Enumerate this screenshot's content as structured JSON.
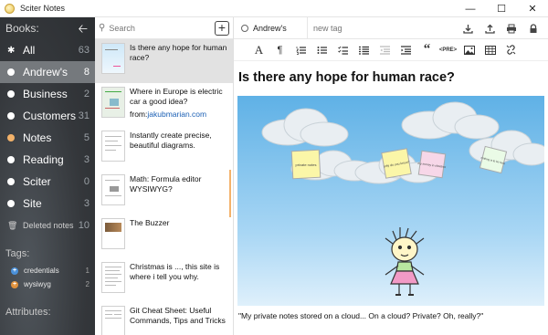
{
  "window": {
    "title": "Sciter Notes"
  },
  "sidebar": {
    "header": "Books:",
    "books": [
      {
        "label": "All",
        "count": "63",
        "icon": "star-icon"
      },
      {
        "label": "Andrew's",
        "count": "8",
        "selected": true
      },
      {
        "label": "Business",
        "count": "2"
      },
      {
        "label": "Customers",
        "count": "31"
      },
      {
        "label": "Notes",
        "count": "5",
        "dot_color": "#f3b26a"
      },
      {
        "label": "Reading",
        "count": "3"
      },
      {
        "label": "Sciter",
        "count": "0"
      },
      {
        "label": "Site",
        "count": "3"
      },
      {
        "label": "Deleted notes",
        "count": "10",
        "icon": "trash-icon"
      }
    ],
    "tags_header": "Tags:",
    "tags": [
      {
        "label": "credentials",
        "count": "1",
        "color": "#4a90d9",
        "symbol": "+"
      },
      {
        "label": "wysiwyg",
        "count": "2",
        "color": "#e0913b",
        "symbol": "+"
      }
    ],
    "attributes_header": "Attributes:"
  },
  "notes_list": {
    "search_placeholder": "Search",
    "notes": [
      {
        "title": "Is there any hope for human race?",
        "selected": true
      },
      {
        "title": "Where in Europe is electric car a good idea?",
        "from_label": "from:",
        "from_link": "jakubmarian.com"
      },
      {
        "title": "Instantly create precise, beautiful diagrams."
      },
      {
        "title": "Math: Formula editor WYSIWYG?"
      },
      {
        "title": "The Buzzer"
      },
      {
        "title": "Christmas is ..., this site is where i tell you why."
      },
      {
        "title": "Git Cheat Sheet: Useful Commands, Tips and Tricks"
      }
    ]
  },
  "editor": {
    "book": "Andrew's",
    "tag_placeholder": "new tag",
    "toolbar": {
      "pre_label": "<PRE>"
    },
    "document_title": "Is there any hope for human race?",
    "caption": "\"My private notes stored on a cloud... On a cloud? Private? Oh, really?\"",
    "illustration_notes": [
      "private notes",
      "only do you know?",
      "my money in shoebox",
      "nothing is to be here"
    ]
  },
  "colors": {
    "sidebar_bg": "#3f4347",
    "selected_book": "#75797d",
    "accent_orange": "#f3b26a",
    "link": "#1a5fb4",
    "sky": "#5fb1e6"
  }
}
